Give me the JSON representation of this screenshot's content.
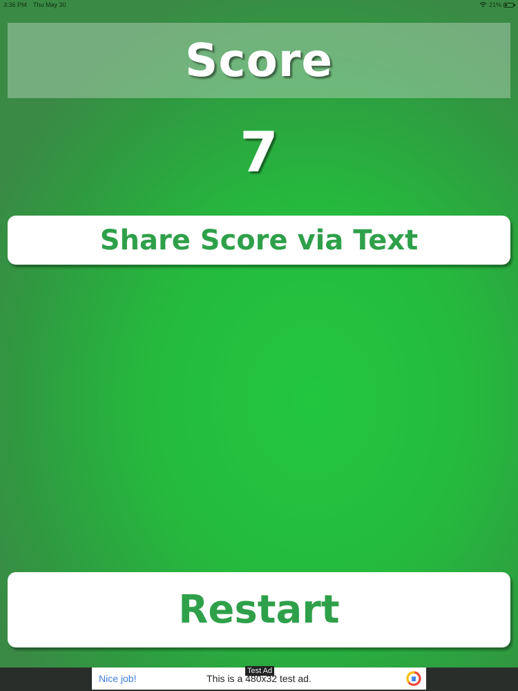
{
  "status_bar": {
    "time": "3:36 PM",
    "date": "Thu May 30",
    "battery": "21%",
    "icons": [
      "wifi-icon",
      "battery-charging-icon"
    ]
  },
  "score": {
    "title": "Score",
    "value": "7"
  },
  "buttons": {
    "share": "Share Score via Text",
    "restart": "Restart"
  },
  "ad": {
    "tag": "Test Ad",
    "headline": "Nice job!",
    "body": "This is a 480x32 test ad.",
    "icon": "adchoices-logo-icon"
  },
  "colors": {
    "background": "#25ba3e",
    "button_text": "#2fa04a",
    "button_bg": "#ffffff",
    "title_text": "#ffffff"
  }
}
